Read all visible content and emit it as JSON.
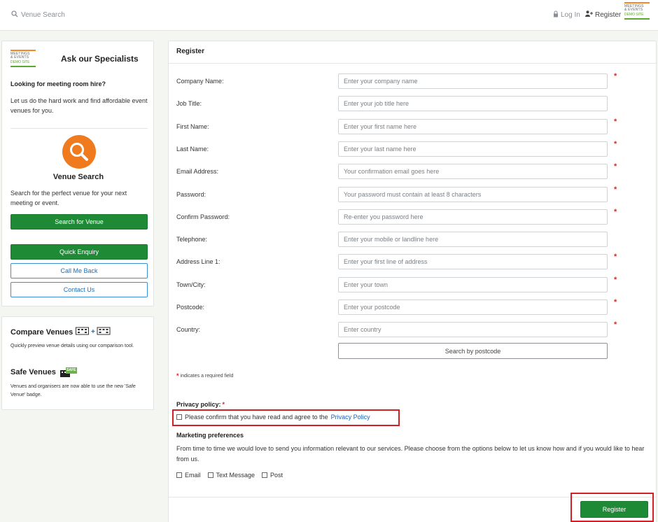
{
  "topbar": {
    "search_label": "Venue Search",
    "login_label": "Log In",
    "register_label": "Register"
  },
  "logo": {
    "line1": "MEETINGS",
    "line2": "& EVENTS",
    "line3": "DEMO SITE"
  },
  "sidebar": {
    "ask_title": "Ask our Specialists",
    "looking": "Looking for meeting room hire?",
    "let_us": "Let us do the hard work and find affordable event venues for you.",
    "venue_title": "Venue Search",
    "venue_desc": "Search for the perfect venue for your next meeting or event.",
    "search_btn": "Search for Venue",
    "quick_btn": "Quick Enquiry",
    "call_btn": "Call Me Back",
    "contact_btn": "Contact Us",
    "compare_title": "Compare Venues",
    "compare_desc": "Quickly preview venue details using our comparison tool.",
    "safe_title": "Safe Venues",
    "safe_desc": "Venues and organisers are now able to use the new 'Safe Venue' badge.",
    "safe_badge": "SAFE"
  },
  "form": {
    "title": "Register",
    "fields": [
      {
        "label": "Company Name:",
        "placeholder": "Enter your company name",
        "required": true
      },
      {
        "label": "Job Title:",
        "placeholder": "Enter your job title here",
        "required": false
      },
      {
        "label": "First Name:",
        "placeholder": "Enter your first name here",
        "required": true
      },
      {
        "label": "Last Name:",
        "placeholder": "Enter your last name here",
        "required": true
      },
      {
        "label": "Email Address:",
        "placeholder": "Your confirmation email goes here",
        "required": true
      },
      {
        "label": "Password:",
        "placeholder": "Your password must contain at least 8 characters",
        "required": true
      },
      {
        "label": "Confirm Password:",
        "placeholder": "Re-enter you password here",
        "required": true
      },
      {
        "label": "Telephone:",
        "placeholder": "Enter your mobile or landline here",
        "required": false
      },
      {
        "label": "Address Line 1:",
        "placeholder": "Enter your first line of address",
        "required": true
      },
      {
        "label": "Town/City:",
        "placeholder": "Enter your town",
        "required": true
      },
      {
        "label": "Postcode:",
        "placeholder": "Enter your postcode",
        "required": true
      },
      {
        "label": "Country:",
        "placeholder": "Enter country",
        "required": true
      }
    ],
    "required_star": "*",
    "postcode_btn": "Search by postcode",
    "required_note": "indicates a required field",
    "privacy_head": "Privacy policy:",
    "privacy_text": "Please confirm that you have read and agree to the",
    "privacy_link": "Privacy Policy",
    "marketing_title": "Marketing preferences",
    "marketing_desc": "From time to time we would love to send you information relevant to our services. Please choose from the options below to let us know how and if you would like to hear from us.",
    "marketing_options": [
      "Email",
      "Text Message",
      "Post"
    ],
    "register_btn": "Register"
  },
  "colors": {
    "accent_green": "#1f8a36",
    "link_blue": "#1a5fb8",
    "required_red": "#d9262c",
    "highlight_red": "#d41f26",
    "orange": "#f07b1e"
  }
}
